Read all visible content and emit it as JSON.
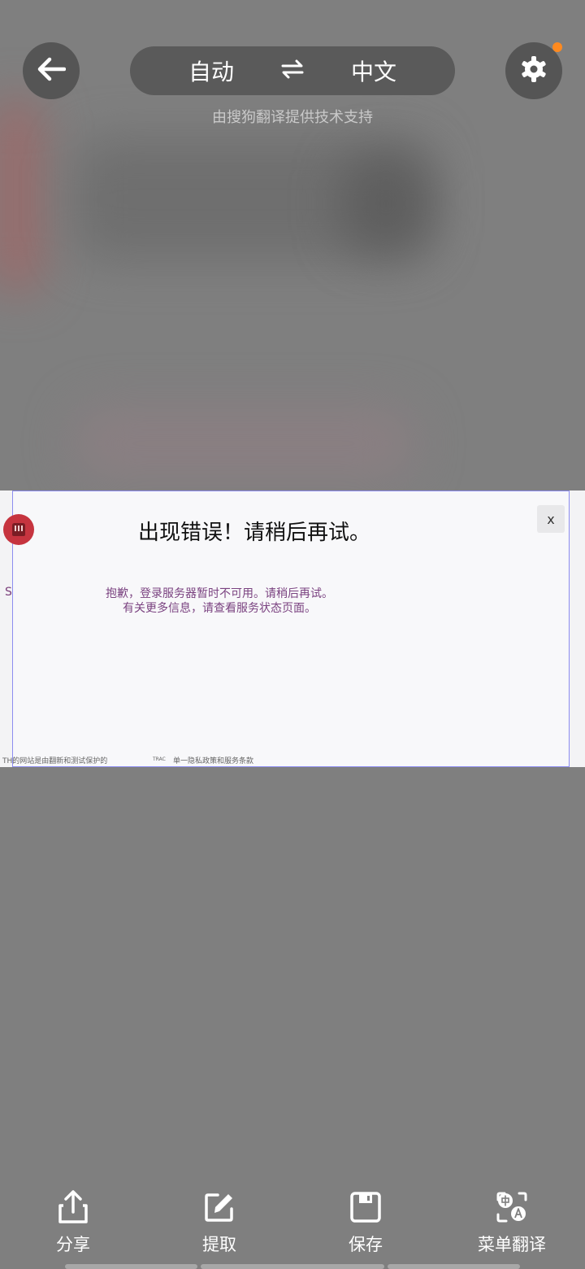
{
  "top_bar": {
    "source_lang": "自动",
    "target_lang": "中文",
    "powered_by": "由搜狗翻译提供技术支持"
  },
  "dialog": {
    "title": "出现错误！请稍后再试。",
    "close_label": "x",
    "stray_letter": "S",
    "message_line1": "抱歉，登录服务器暂时不可用。请稍后再试。",
    "message_line2": "有关更多信息，请查看服务状态页面。",
    "footer_left": "TH的网站是由翻新和测试保护的",
    "footer_mid": "TRAC",
    "footer_right": "单一隐私政策和服务条款"
  },
  "bottom_bar": {
    "share": "分享",
    "extract": "提取",
    "save": "保存",
    "menu_translate": "菜单翻译"
  },
  "colors": {
    "background": "#7f7f7f",
    "button": "#555555",
    "notification": "#ff8a1f",
    "dialog_border": "#8c8cf0",
    "brand_red": "#c6343f",
    "message_purple": "#7a4280"
  }
}
